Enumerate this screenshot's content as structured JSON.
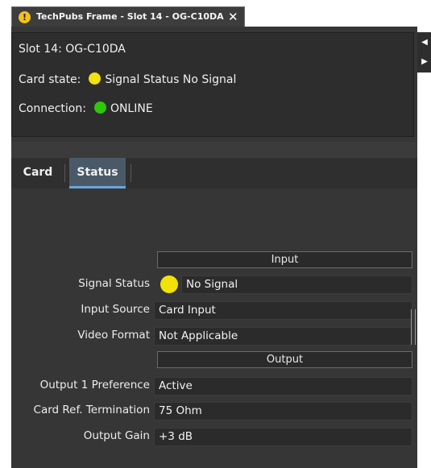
{
  "window": {
    "tab_title": "TechPubs Frame - Slot 14 - OG-C10DA",
    "close_glyph": "✕"
  },
  "header": {
    "slot": "Slot 14: OG-C10DA",
    "card_state_label": "Card state:",
    "card_state_value": "Signal Status No Signal",
    "card_state_color": "#f1e20a",
    "connection_label": "Connection:",
    "connection_value": "ONLINE",
    "connection_color": "#2ec70a"
  },
  "tabs": [
    {
      "label": "Card",
      "active": false
    },
    {
      "label": "Status",
      "active": true
    }
  ],
  "sections": {
    "input_title": "Input",
    "output_title": "Output"
  },
  "rows": {
    "signal_status": {
      "label": "Signal Status",
      "value": "No Signal",
      "indicator": "yellow"
    },
    "input_source": {
      "label": "Input Source",
      "value": "Card Input"
    },
    "video_format": {
      "label": "Video Format",
      "value": "Not Applicable"
    },
    "output1_pref": {
      "label": "Output 1 Preference",
      "value": "Active"
    },
    "card_ref_term": {
      "label": "Card Ref. Termination",
      "value": "75 Ohm"
    },
    "output_gain": {
      "label": "Output Gain",
      "value": "+3 dB"
    }
  },
  "icons": {
    "warning": "warning-icon",
    "close": "close-icon",
    "arrow_left": "chevron-left-icon",
    "arrow_right": "chevron-right-icon"
  }
}
